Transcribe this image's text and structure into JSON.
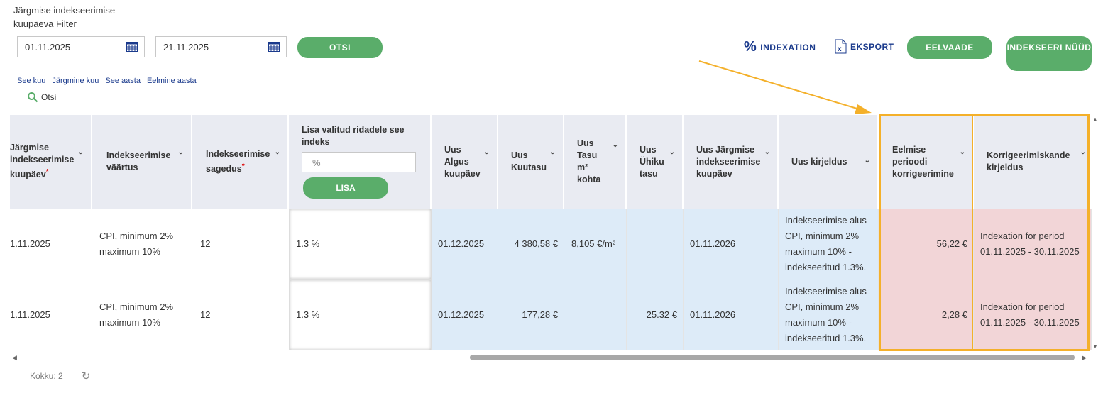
{
  "filter": {
    "title": "Järgmise indekseerimise kuupäeva Filter",
    "date_from": "01.11.2025",
    "date_to": "21.11.2025",
    "search_button": "OTSI",
    "quick_links": [
      "See kuu",
      "Järgmine kuu",
      "See aasta",
      "Eelmine aasta"
    ],
    "search_small": "Otsi"
  },
  "toolbar": {
    "indexation": "INDEXATION",
    "export": "EKSPORT",
    "preview": "EELVAADE",
    "index_now": "INDEKSEERI NÜÜD"
  },
  "columns": {
    "next_index_date": "Järgmise indekseerimise kuupäev",
    "index_value": "Indekseerimise väärtus",
    "frequency": "Indekseerimise sagedus",
    "add_index": "Lisa valitud ridadele see indeks",
    "add_index_placeholder": "%",
    "add_button": "LISA",
    "new_start": "Uus Algus kuupäev",
    "new_rent": "Uus Kuutasu",
    "new_fee_m2": "Uus Tasu m² kohta",
    "new_unit_fee": "Uus Ühiku tasu",
    "new_next_date": "Uus Järgmise indekseerimise kuupäev",
    "new_description": "Uus kirjeldus",
    "prev_correction": "Eelmise perioodi korrigeerimine",
    "correction_desc": "Korrigeerimiskande kirjeldus"
  },
  "rows": [
    {
      "next_index_date": "1.11.2025",
      "index_value": "CPI, minimum 2% maximum 10%",
      "frequency": "12",
      "index": "1.3 %",
      "new_start": "01.12.2025",
      "new_rent": "4 380,58 €",
      "new_fee_m2": "8,105 €/m²",
      "new_unit_fee": "",
      "new_next_date": "01.11.2026",
      "new_description": "Indekseerimise alus CPI, minimum 2% maximum 10% - indekseeritud 1.3%.",
      "prev_correction": "56,22 €",
      "correction_desc": "Indexation for period 01.11.2025 - 30.11.2025"
    },
    {
      "next_index_date": "1.11.2025",
      "index_value": "CPI, minimum 2% maximum 10%",
      "frequency": "12",
      "index": "1.3 %",
      "new_start": "01.12.2025",
      "new_rent": "177,28 €",
      "new_fee_m2": "",
      "new_unit_fee": "25.32 €",
      "new_next_date": "01.11.2026",
      "new_description": "Indekseerimise alus CPI, minimum 2% maximum 10% - indekseeritud 1.3%.",
      "prev_correction": "2,28 €",
      "correction_desc": "Indexation for period 01.11.2025 - 30.11.2025"
    }
  ],
  "footer": {
    "total": "Kokku: 2"
  },
  "colors": {
    "accent_green": "#5aad6a",
    "link_blue": "#1a3a8c",
    "highlight": "#f4b02a",
    "blue_cell": "#ddebf8",
    "pink_cell": "#f2d5d7"
  }
}
